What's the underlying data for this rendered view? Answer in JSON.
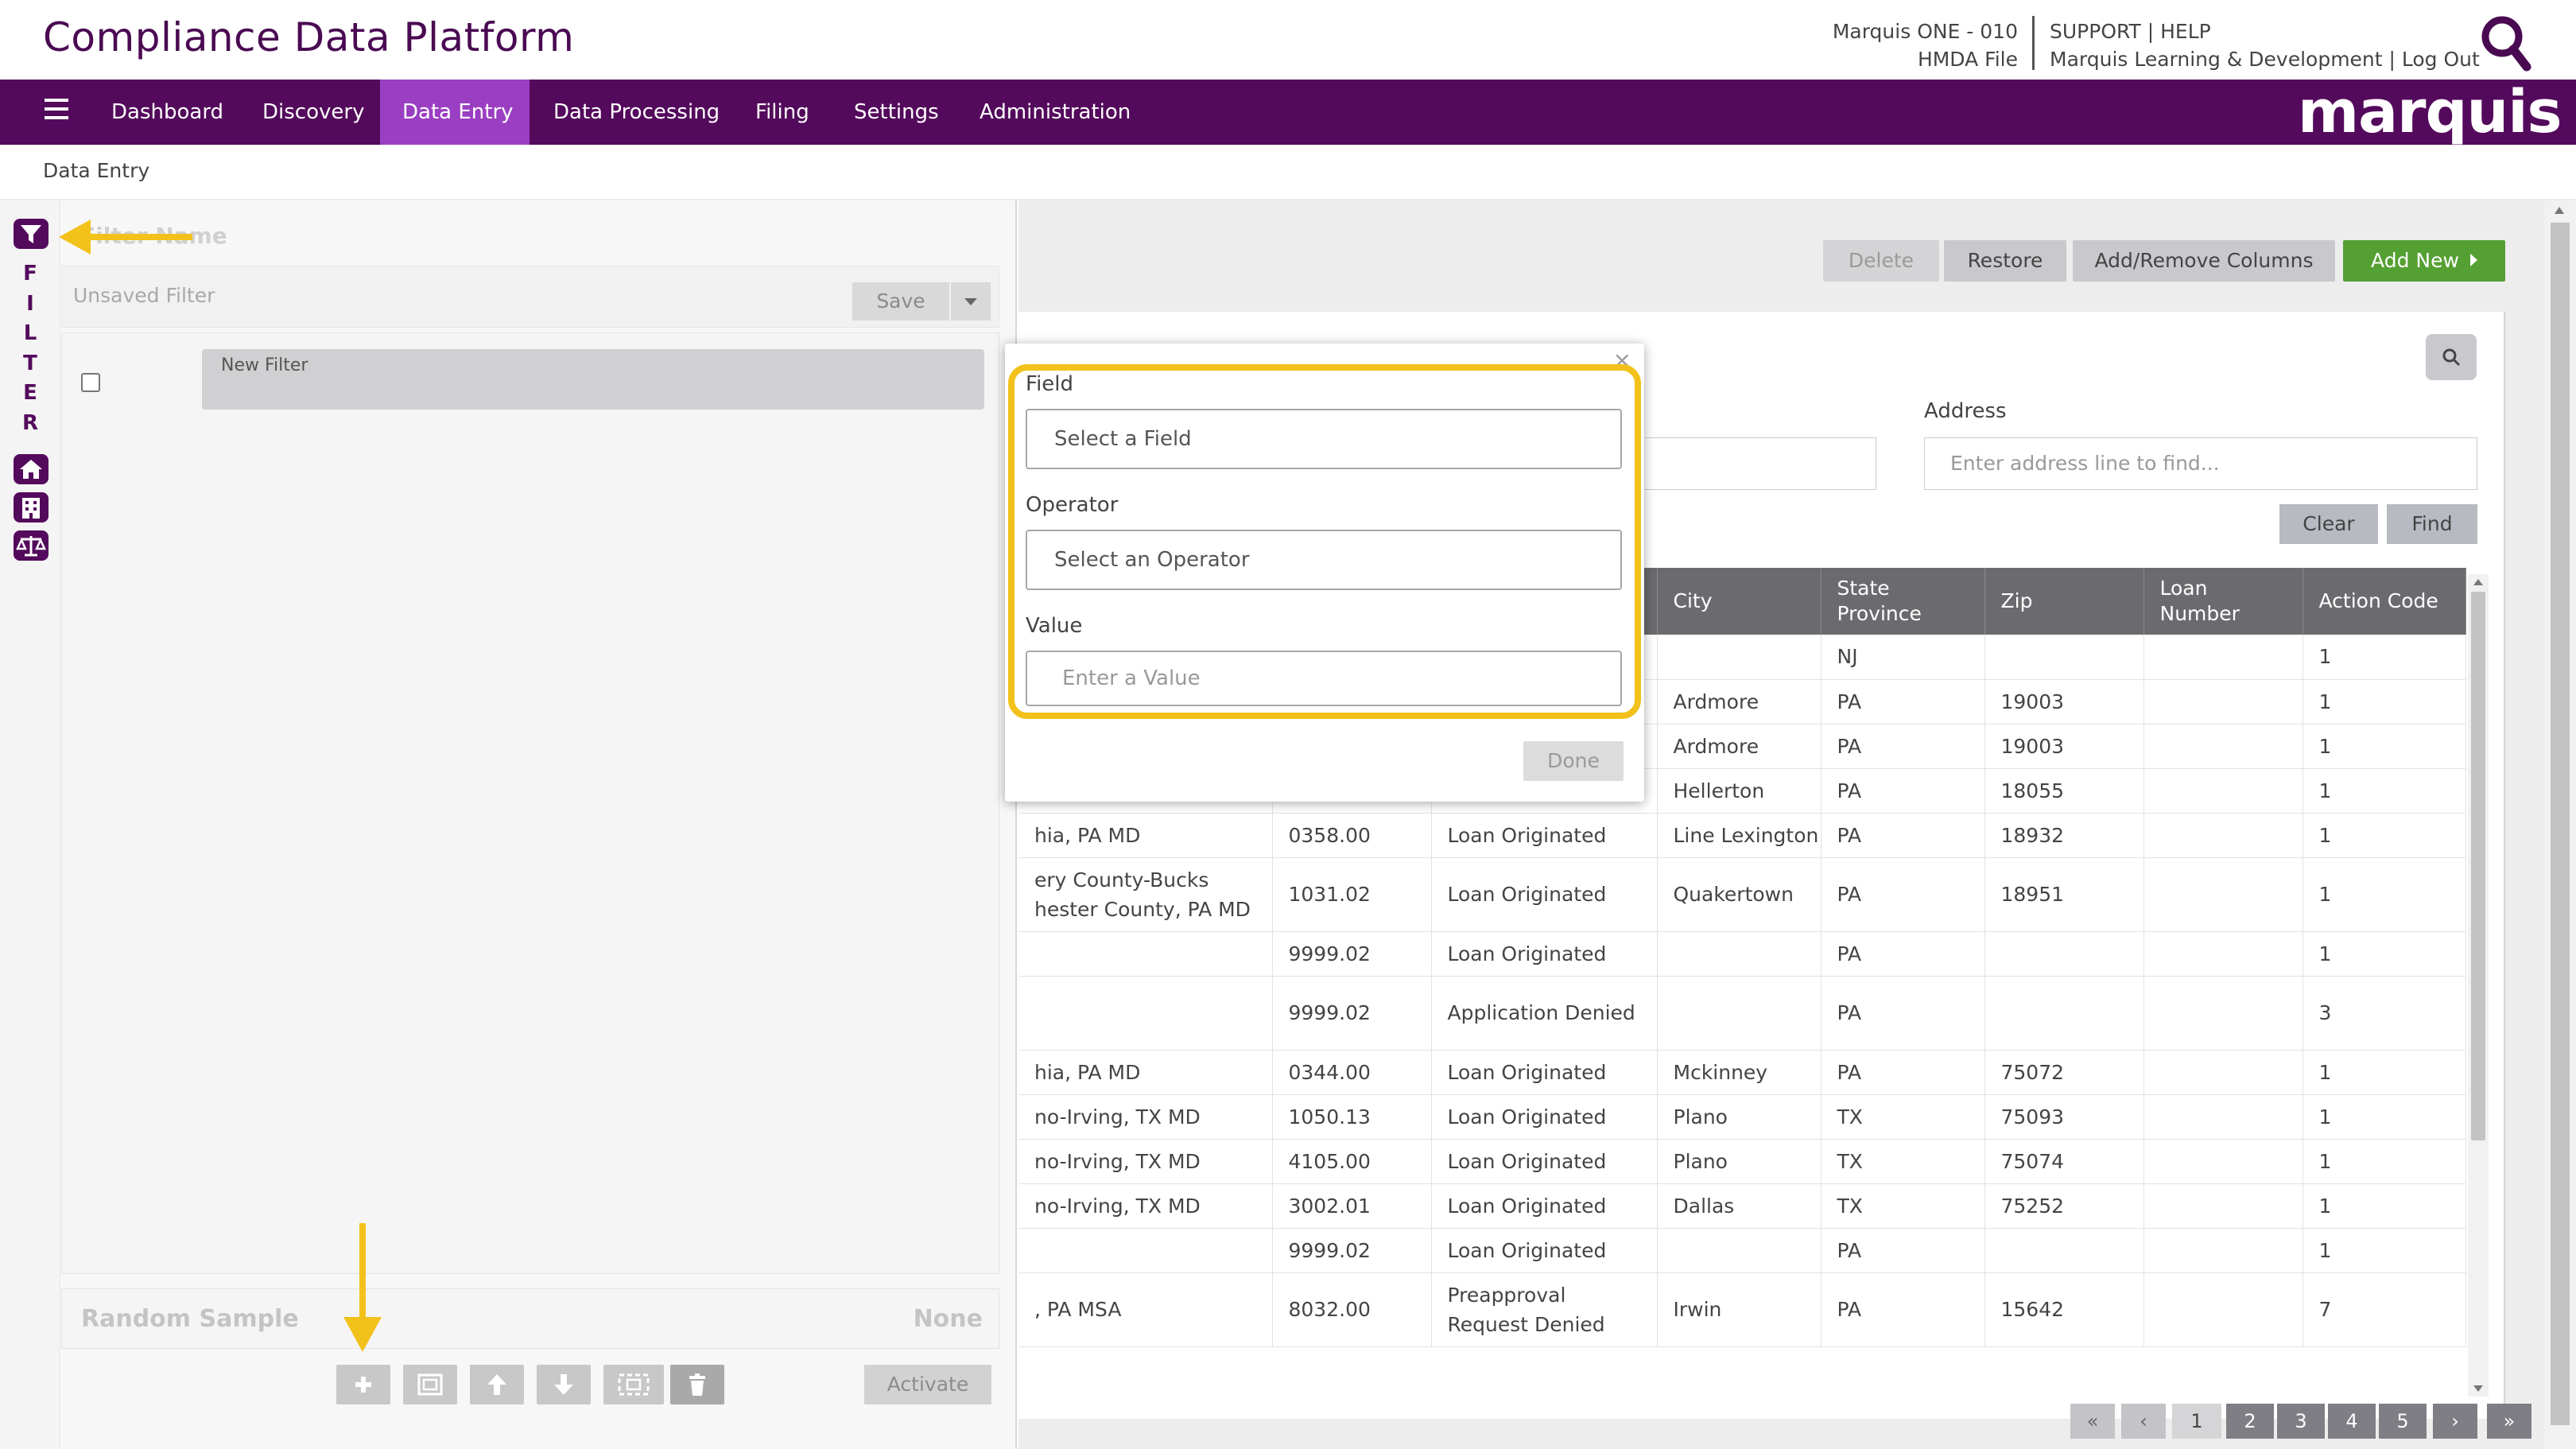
{
  "header": {
    "app_title": "Compliance Data Platform",
    "account_line1": "Marquis ONE - 010",
    "account_line2": "HMDA File",
    "links_line1": "SUPPORT | HELP",
    "links_line2": "Marquis Learning & Development | Log Out",
    "search_icon": "search-icon"
  },
  "nav": {
    "menu_icon": "hamburger-icon",
    "items": [
      "Dashboard",
      "Discovery",
      "Data Entry",
      "Data Processing",
      "Filing",
      "Settings",
      "Administration"
    ],
    "active": "Data Entry",
    "brand": "marquis",
    "colors": {
      "bar": "#540a5c",
      "active": "#9b3fc2"
    }
  },
  "breadcrumb": "Data Entry",
  "side_strip": {
    "icons": [
      "filter-icon",
      "home-icon",
      "building-icon",
      "scales-icon"
    ],
    "filter_letters": [
      "F",
      "I",
      "L",
      "T",
      "E",
      "R"
    ]
  },
  "filter_panel": {
    "name_label": "Filter Name",
    "name_value": "Unsaved Filter",
    "save_label": "Save",
    "new_filter_label": "New Filter",
    "random_sample_label": "Random Sample",
    "random_sample_value": "None",
    "activate_label": "Activate",
    "toolbar_icons": [
      "plus-icon",
      "group-icon",
      "arrow-up-icon",
      "arrow-down-icon",
      "ungroup-icon",
      "trash-icon"
    ]
  },
  "toolbar": {
    "delete": "Delete",
    "restore": "Restore",
    "add_remove_columns": "Add/Remove Columns",
    "add_new": "Add New",
    "add_new_color": "#55a032"
  },
  "search": {
    "address_label": "Address",
    "address_placeholder": "Enter address line to find...",
    "clear": "Clear",
    "find": "Find"
  },
  "table": {
    "columns": [
      "",
      "",
      "",
      "City",
      "State Province",
      "Zip",
      "Loan Number",
      "Action Code"
    ],
    "rows": [
      [
        "",
        "",
        "",
        "",
        "NJ",
        "",
        "",
        "1"
      ],
      [
        "",
        "",
        "",
        "Ardmore",
        "PA",
        "19003",
        "",
        "1"
      ],
      [
        "",
        "",
        "",
        "Ardmore",
        "PA",
        "19003",
        "",
        "1"
      ],
      [
        "",
        "",
        "",
        "Hellerton",
        "PA",
        "18055",
        "",
        "1"
      ],
      [
        "hia, PA MD",
        "0358.00",
        "Loan Originated",
        "Line Lexington",
        "PA",
        "18932",
        "",
        "1"
      ],
      [
        "ery County-Bucks\nhester County, PA MD",
        "1031.02",
        "Loan Originated",
        "Quakertown",
        "PA",
        "18951",
        "",
        "1"
      ],
      [
        "",
        "9999.02",
        "Loan Originated",
        "",
        "PA",
        "",
        "",
        "1"
      ],
      [
        "",
        "9999.02",
        "Application Denied",
        "",
        "PA",
        "",
        "",
        "3"
      ],
      [
        "hia, PA MD",
        "0344.00",
        "Loan Originated",
        "Mckinney",
        "PA",
        "75072",
        "",
        "1"
      ],
      [
        "no-Irving, TX MD",
        "1050.13",
        "Loan Originated",
        "Plano",
        "TX",
        "75093",
        "",
        "1"
      ],
      [
        "no-Irving, TX MD",
        "4105.00",
        "Loan Originated",
        "Plano",
        "TX",
        "75074",
        "",
        "1"
      ],
      [
        "no-Irving, TX MD",
        "3002.01",
        "Loan Originated",
        "Dallas",
        "TX",
        "75252",
        "",
        "1"
      ],
      [
        "",
        "9999.02",
        "Loan Originated",
        "",
        "PA",
        "",
        "",
        "1"
      ],
      [
        ", PA MSA",
        "8032.00",
        "Preapproval Request Denied",
        "Irwin",
        "PA",
        "15642",
        "",
        "7"
      ]
    ]
  },
  "pagination": {
    "first": "«",
    "prev": "‹",
    "pages": [
      "1",
      "2",
      "3",
      "4",
      "5"
    ],
    "current": "1",
    "next": "›",
    "last": "»"
  },
  "popup": {
    "close": "×",
    "field_label": "Field",
    "field_placeholder": "Select a Field",
    "operator_label": "Operator",
    "operator_placeholder": "Select an Operator",
    "value_label": "Value",
    "value_placeholder": "Enter a Value",
    "done": "Done",
    "highlight_color": "#f2c21b"
  }
}
